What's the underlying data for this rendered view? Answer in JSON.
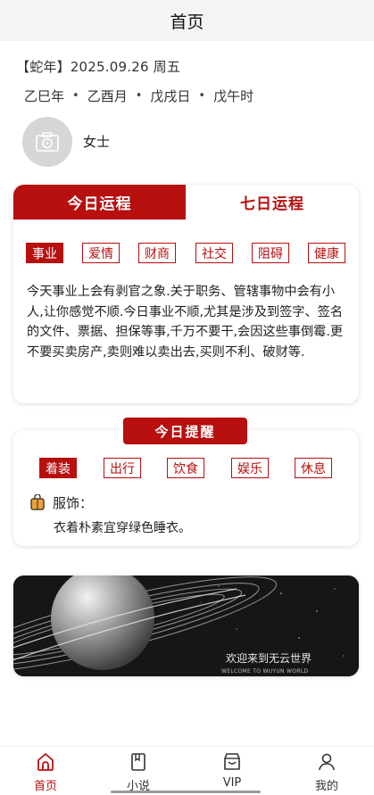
{
  "header": {
    "title": "首页"
  },
  "profile": {
    "date_line": "【蛇年】2025.09.26 周五",
    "ganzhi": [
      "乙巳年",
      "乙酉月",
      "戊戌日",
      "戊午时"
    ],
    "separator": "•",
    "name": "女士"
  },
  "fortune": {
    "tabs": [
      "今日运程",
      "七日运程"
    ],
    "active_tab": 0,
    "categories": [
      "事业",
      "爱情",
      "财商",
      "社交",
      "阻碍",
      "健康"
    ],
    "selected_category": 0,
    "text": "今天事业上会有剥官之象.关于职务、管辖事物中会有小人,让你感觉不顺.今日事业不顺,尤其是涉及到签字、签名的文件、票据、担保等事,千万不要干,会因这些事倒霉.更不要买卖房产,卖则难以卖出去,买则不利、破财等."
  },
  "reminder": {
    "title": "今日提醒",
    "categories": [
      "着装",
      "出行",
      "饮食",
      "娱乐",
      "休息"
    ],
    "selected_category": 0,
    "item_label": "服饰：",
    "item_text": "衣着朴素宜穿绿色睡衣。"
  },
  "banner": {
    "title": "欢迎来到无云世界",
    "subtitle": "WELCOME TO WUYUN WORLD"
  },
  "tabbar": {
    "items": [
      {
        "label": "首页",
        "icon": "home-icon"
      },
      {
        "label": "小说",
        "icon": "book-icon"
      },
      {
        "label": "VIP",
        "icon": "vip-shop-icon"
      },
      {
        "label": "我的",
        "icon": "user-icon"
      }
    ],
    "active": 0
  },
  "colors": {
    "accent": "#b80f0f",
    "header_bg": "#f4f4f4",
    "avatar_bg": "#d6d6d6",
    "banner_bg": "#161616"
  }
}
